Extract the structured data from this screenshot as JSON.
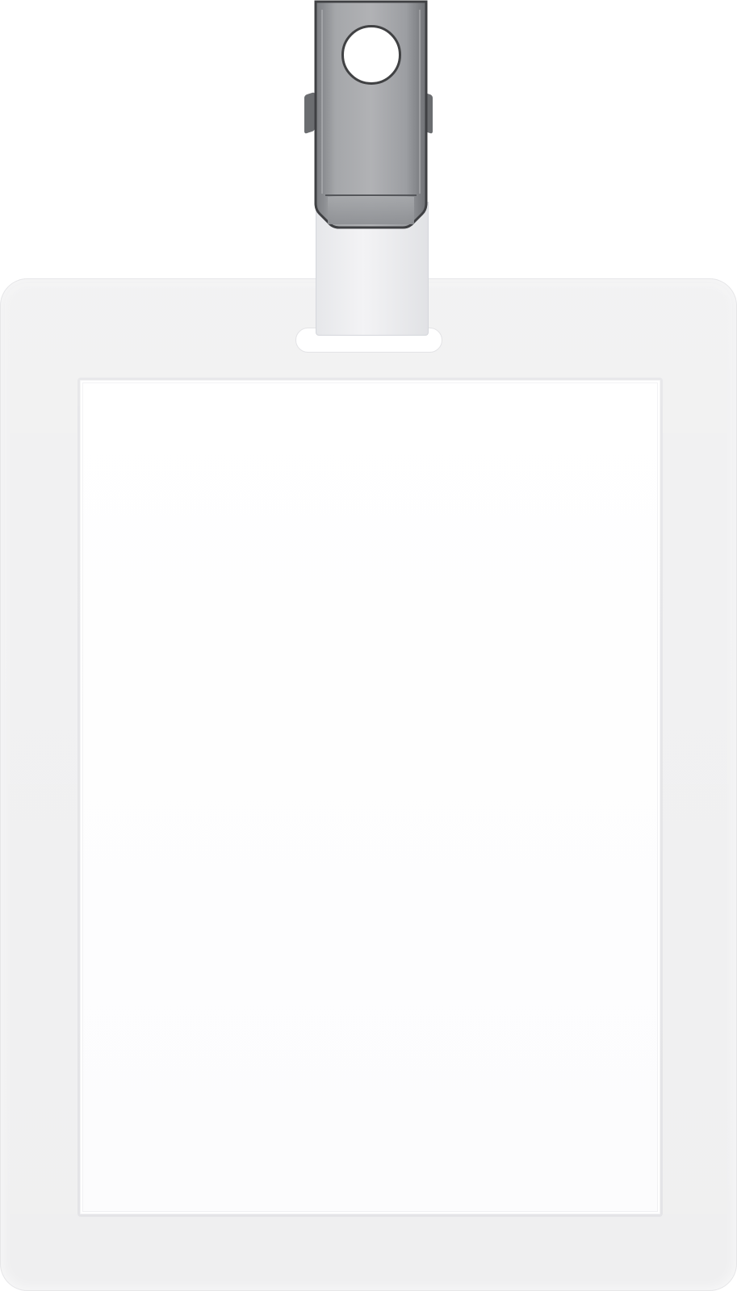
{
  "image": {
    "subject": "blank-badge-holder-with-clip"
  },
  "colors": {
    "background": "#ffffff",
    "holder": "#efeff0",
    "window": "#ffffff",
    "clip_metal": "#9b9c9f",
    "clip_outline": "#3f4043",
    "strap": "#ededf0"
  }
}
